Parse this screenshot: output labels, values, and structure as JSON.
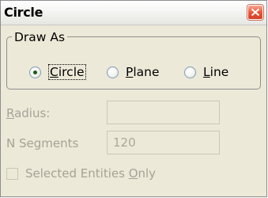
{
  "window": {
    "title": "Circle"
  },
  "draw_as": {
    "legend": "Draw As",
    "options": [
      {
        "label_ul": "C",
        "label_rest": "ircle",
        "checked": true
      },
      {
        "label_ul": "P",
        "label_rest": "lane",
        "checked": false
      },
      {
        "label_ul": "L",
        "label_rest": "ine",
        "checked": false
      }
    ]
  },
  "fields": {
    "radius_label_ul": "R",
    "radius_label_rest": "adius:",
    "radius_value": "",
    "nsegments_label": "N Segments",
    "nsegments_value": "120"
  },
  "selected_only": {
    "label_pre": "Selected Entities ",
    "label_ul": "O",
    "label_rest": "nly",
    "checked": false
  },
  "icons": {
    "close": "close-icon"
  },
  "colors": {
    "dialog_bg": "#ece9d8",
    "disabled_text": "#a4a396",
    "close_red": "#e0502f"
  }
}
